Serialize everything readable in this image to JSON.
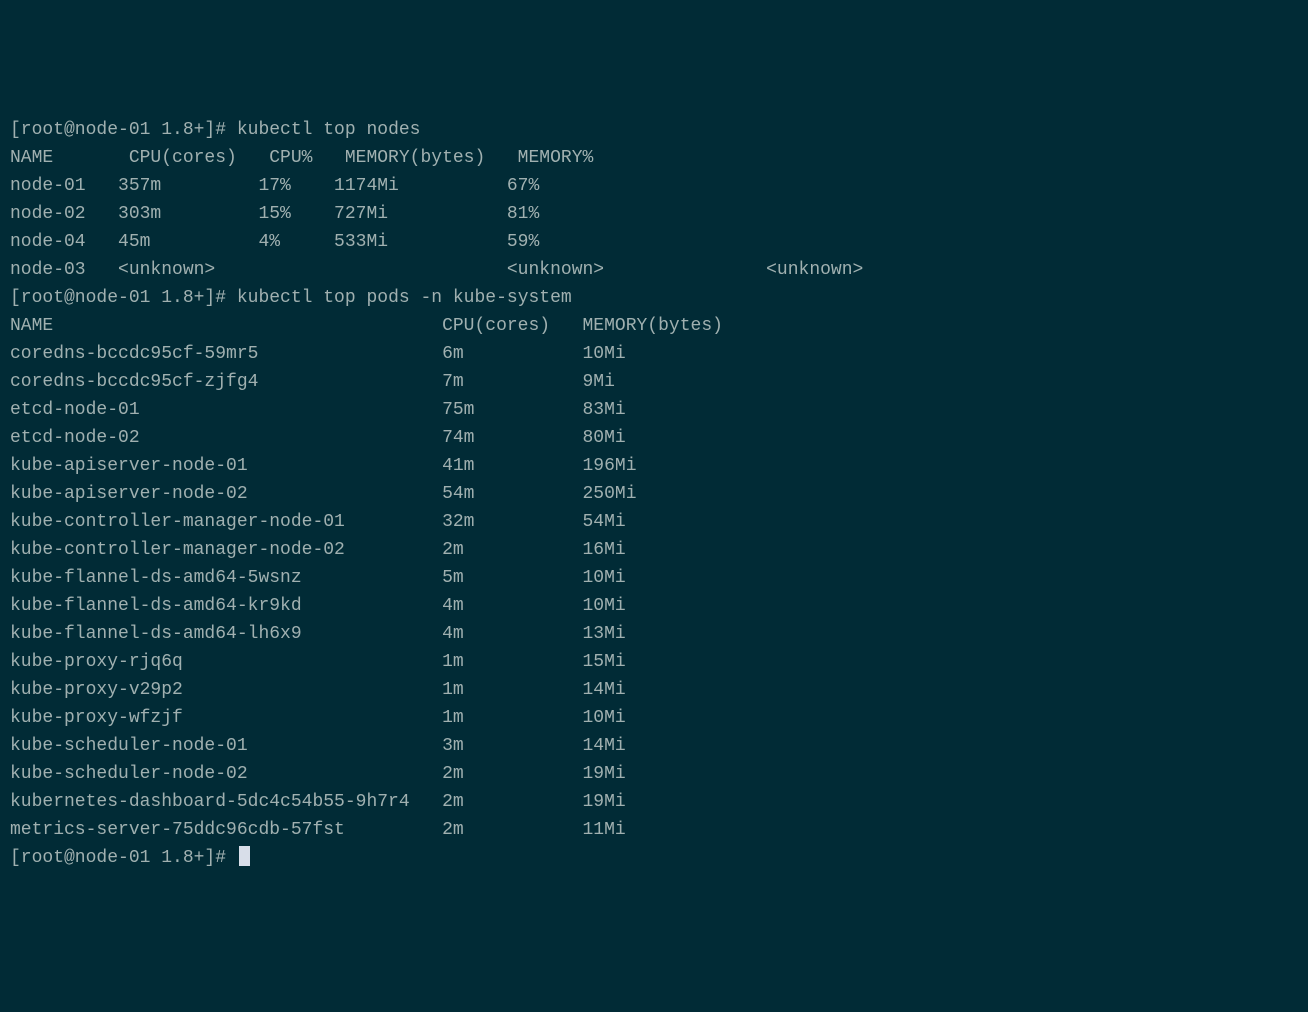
{
  "prompt1": "[root@node-01 1.8+]# ",
  "cmd1": "kubectl top nodes",
  "nodes_header": "NAME       CPU(cores)   CPU%   MEMORY(bytes)   MEMORY%",
  "nodes": [
    "node-01   357m         17%    1174Mi          67%",
    "node-02   303m         15%    727Mi           81%",
    "node-04   45m          4%     533Mi           59%",
    "node-03   <unknown>                           <unknown>               <unknown>"
  ],
  "prompt2": "[root@node-01 1.8+]# ",
  "cmd2": "kubectl top pods -n kube-system",
  "pods_header": "NAME                                    CPU(cores)   MEMORY(bytes)",
  "pods": [
    "coredns-bccdc95cf-59mr5                 6m           10Mi",
    "coredns-bccdc95cf-zjfg4                 7m           9Mi",
    "etcd-node-01                            75m          83Mi",
    "etcd-node-02                            74m          80Mi",
    "kube-apiserver-node-01                  41m          196Mi",
    "kube-apiserver-node-02                  54m          250Mi",
    "kube-controller-manager-node-01         32m          54Mi",
    "kube-controller-manager-node-02         2m           16Mi",
    "kube-flannel-ds-amd64-5wsnz             5m           10Mi",
    "kube-flannel-ds-amd64-kr9kd             4m           10Mi",
    "kube-flannel-ds-amd64-lh6x9             4m           13Mi",
    "kube-proxy-rjq6q                        1m           15Mi",
    "kube-proxy-v29p2                        1m           14Mi",
    "kube-proxy-wfzjf                        1m           10Mi",
    "kube-scheduler-node-01                  3m           14Mi",
    "kube-scheduler-node-02                  2m           19Mi",
    "kubernetes-dashboard-5dc4c54b55-9h7r4   2m           19Mi",
    "metrics-server-75ddc96cdb-57fst         2m           11Mi"
  ],
  "prompt3": "[root@node-01 1.8+]# "
}
